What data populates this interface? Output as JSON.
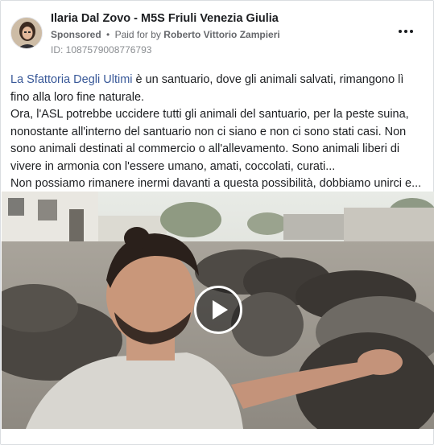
{
  "post": {
    "author": "Ilaria Dal Zovo - M5S Friuli Venezia Giulia",
    "sponsored_label": "Sponsored",
    "separator": "•",
    "paid_for_prefix": "Paid for by",
    "paid_for_name": "Roberto Vittorio Zampieri",
    "ad_id": "ID: 1087579008776793",
    "more_icon": "more-horizontal-icon"
  },
  "body": {
    "link_text": "La Sfattoria Degli Ultimi",
    "line1_rest": " è un santuario, dove gli animali salvati, rimangono lì fino alla loro fine naturale.",
    "paragraph2": "Ora, l'ASL potrebbe uccidere tutti gli animali del santuario, per la peste suina, nonostante all'interno del santuario non ci siano e non ci sono stati casi. Non sono animali destinati al commercio o all'allevamento. Sono animali liberi di vivere in armonia con l'essere umano, amati, coccolati, curati...",
    "paragraph3": "Non possiamo rimanere inermi davanti a questa possibilità, dobbiamo unirci e..."
  },
  "video": {
    "play_icon": "play-icon",
    "colors": {
      "link": "#385898",
      "secondary_text": "#65676b",
      "border": "#dadde1"
    }
  }
}
